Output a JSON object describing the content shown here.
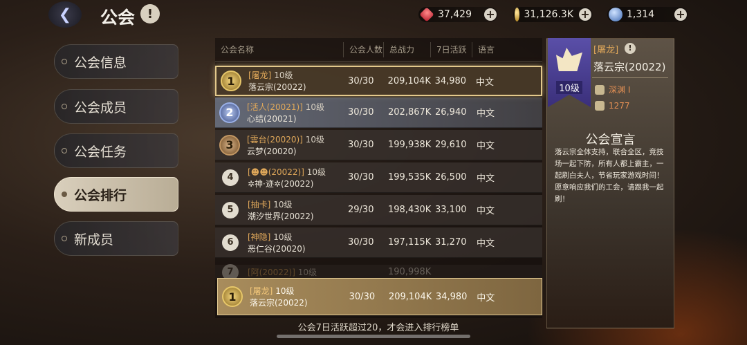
{
  "header": {
    "title": "公会",
    "help": "!",
    "back_icon": "back-arrow-icon"
  },
  "currencies": [
    {
      "icon": "ruby-icon",
      "value": "37,429",
      "plus": "+"
    },
    {
      "icon": "gold-coin-icon",
      "value": "31,126.3K",
      "plus": "+"
    },
    {
      "icon": "gem-icon",
      "value": "1,314",
      "plus": "+"
    }
  ],
  "sidebar": {
    "items": [
      {
        "label": "公会信息"
      },
      {
        "label": "公会成员"
      },
      {
        "label": "公会任务"
      },
      {
        "label": "公会排行",
        "active": true
      },
      {
        "label": "新成员"
      }
    ]
  },
  "table": {
    "headers": [
      "公会名称",
      "公会人数",
      "总战力",
      "7日活跃",
      "语言"
    ],
    "rows": [
      {
        "rank": "1",
        "tag": "[屠龙]",
        "level": "10级",
        "name": "落云宗(20022)",
        "members": "30/30",
        "power": "209,104K",
        "active": "34,980",
        "lang": "中文"
      },
      {
        "rank": "2",
        "tag": "[活人(20021)]",
        "level": "10级",
        "name": "心结(20021)",
        "members": "30/30",
        "power": "202,867K",
        "active": "26,940",
        "lang": "中文"
      },
      {
        "rank": "3",
        "tag": "[雲台(20020)]",
        "level": "10级",
        "name": "云梦(20020)",
        "members": "30/30",
        "power": "199,938K",
        "active": "29,610",
        "lang": "中文"
      },
      {
        "rank": "4",
        "tag": "[☻☻(20022)]",
        "level": "10级",
        "name": "✲神·迹✲(20022)",
        "members": "30/30",
        "power": "199,535K",
        "active": "26,500",
        "lang": "中文"
      },
      {
        "rank": "5",
        "tag": "[抽卡]",
        "level": "10级",
        "name": "潮汐世界(20022)",
        "members": "29/30",
        "power": "198,430K",
        "active": "33,100",
        "lang": "中文"
      },
      {
        "rank": "6",
        "tag": "[神隐]",
        "level": "10级",
        "name": "恶仁谷(20020)",
        "members": "30/30",
        "power": "197,115K",
        "active": "31,270",
        "lang": "中文"
      },
      {
        "rank": "7",
        "tag": "[阿(20022)]",
        "level": "10级",
        "name": "",
        "members": "",
        "power": "190,998K",
        "active": "",
        "lang": ""
      }
    ],
    "my_guild": {
      "rank": "1",
      "tag": "[屠龙]",
      "level": "10级",
      "name": "落云宗(20022)",
      "members": "30/30",
      "power": "209,104K",
      "active": "34,980",
      "lang": "中文"
    },
    "footer": "公会7日活跃超过20，才会进入排行榜单"
  },
  "detail": {
    "tag": "[屠龙]",
    "help": "!",
    "name": "落云宗(20022)",
    "level": "10级",
    "stat1": "深渊 I",
    "stat2": "1277",
    "section_title": "公会宣言",
    "declaration": "落云宗全体支持，联合全区，竞技场一起下防，所有人都上霸主，一起刷白夫人，节省玩家游戏时间！愿意响应我们的工会，请跟我一起刷！"
  }
}
